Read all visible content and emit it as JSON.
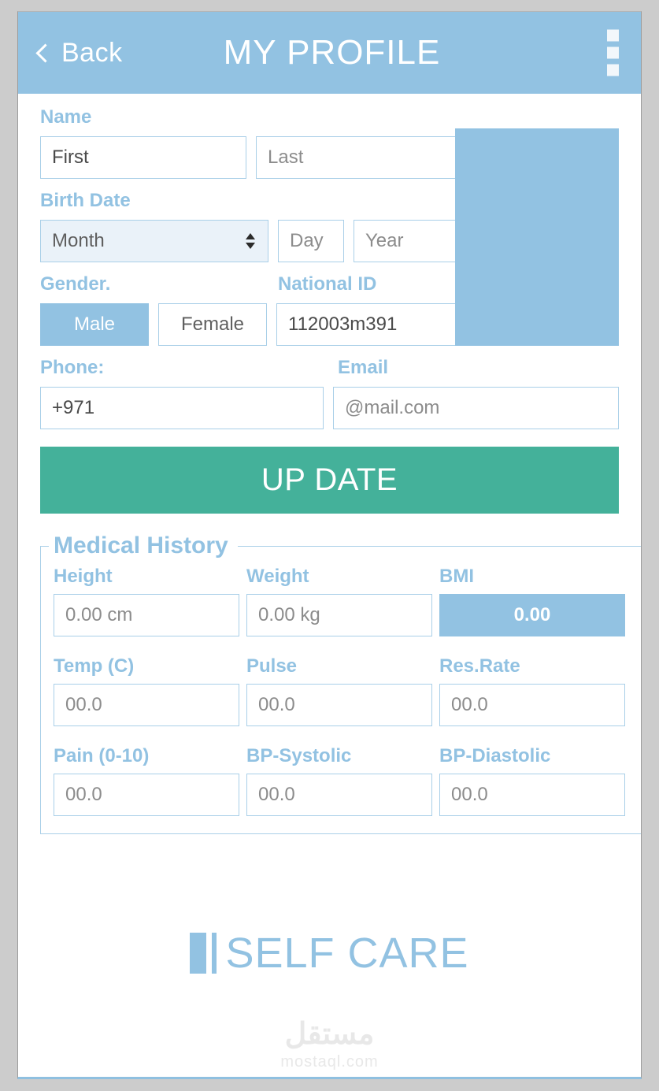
{
  "header": {
    "back_label": "Back",
    "title": "MY PROFILE",
    "back_icon": "chevron-left-icon",
    "menu_icon": "vertical-dots-menu-icon"
  },
  "form": {
    "name": {
      "label": "Name",
      "first_value": "First",
      "first_placeholder": "First",
      "last_value": "Last",
      "last_placeholder": "Last"
    },
    "birth_date": {
      "label": "Birth Date",
      "month_value": "Month",
      "month_options": [
        "Month"
      ],
      "day_value": "Day",
      "day_placeholder": "Day",
      "year_value": "Year",
      "year_placeholder": "Year"
    },
    "gender": {
      "label": "Gender.",
      "male_label": "Male",
      "female_label": "Female",
      "selected": "Male"
    },
    "national_id": {
      "label": "National ID",
      "value": "112003m391",
      "placeholder": "112003m391"
    },
    "phone": {
      "label": "Phone:",
      "value": "+971",
      "placeholder": "+971"
    },
    "email": {
      "label": "Email",
      "value": "@mail.com",
      "placeholder": "@mail.com"
    },
    "update_button": "UP DATE"
  },
  "medical_history": {
    "legend": "Medical History",
    "rows": [
      {
        "fields": [
          {
            "label": "Height",
            "value": "0.00 cm",
            "placeholder": "0.00 cm",
            "readonly": false
          },
          {
            "label": "Weight",
            "value": "0.00 kg",
            "placeholder": "0.00 kg",
            "readonly": false
          },
          {
            "label": "BMI",
            "value": "0.00",
            "placeholder": "0.00",
            "readonly": true
          }
        ]
      },
      {
        "fields": [
          {
            "label": "Temp (C)",
            "value": "00.0",
            "placeholder": "00.0",
            "readonly": false
          },
          {
            "label": "Pulse",
            "value": "00.0",
            "placeholder": "00.0",
            "readonly": false
          },
          {
            "label": "Res.Rate",
            "value": "00.0",
            "placeholder": "00.0",
            "readonly": false
          }
        ]
      },
      {
        "fields": [
          {
            "label": "Pain (0-10)",
            "value": "00.0",
            "placeholder": "00.0",
            "readonly": false
          },
          {
            "label": "BP-Systolic",
            "value": "00.0",
            "placeholder": "00.0",
            "readonly": false
          },
          {
            "label": "BP-Diastolic",
            "value": "00.0",
            "placeholder": "00.0",
            "readonly": false
          }
        ]
      }
    ]
  },
  "branding": {
    "name": "SELF CARE",
    "logo_icon": "two-bars-logo-icon"
  },
  "watermark": {
    "arabic": "مستقل",
    "latin": "mostaql.com"
  },
  "colors": {
    "brand_blue": "#92c2e2",
    "accent_green": "#44b19a",
    "field_border": "#a9cfe8",
    "select_bg": "#eaf2f9",
    "frame_gray": "#cccccc"
  }
}
